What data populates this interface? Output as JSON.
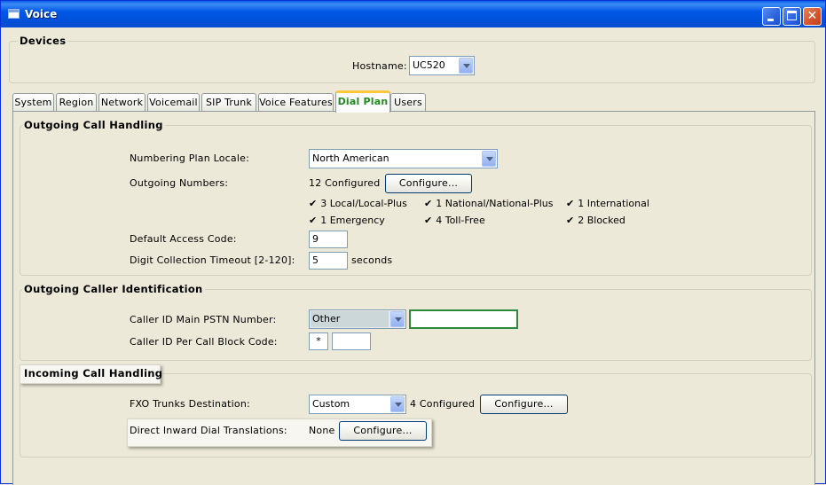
{
  "window": {
    "title": "Voice"
  },
  "devices": {
    "legend": "Devices",
    "hostname_label": "Hostname:",
    "hostname_value": "UC520"
  },
  "tabs": [
    {
      "label": "System"
    },
    {
      "label": "Region"
    },
    {
      "label": "Network"
    },
    {
      "label": "Voicemail"
    },
    {
      "label": "SIP Trunk"
    },
    {
      "label": "Voice Features"
    },
    {
      "label": "Dial Plan",
      "active": true
    },
    {
      "label": "Users"
    }
  ],
  "outgoing": {
    "legend": "Outgoing Call Handling",
    "locale_label": "Numbering Plan Locale:",
    "locale_value": "North American",
    "numbers_label": "Outgoing Numbers:",
    "numbers_status": "12 Configured",
    "configure_label": "Configure...",
    "checks": [
      "3 Local/Local-Plus",
      "1 National/National-Plus",
      "1 International",
      "1 Emergency",
      "4 Toll-Free",
      "2 Blocked"
    ],
    "access_code_label": "Default Access Code:",
    "access_code_value": "9",
    "timeout_label": "Digit Collection Timeout [2-120]:",
    "timeout_value": "5",
    "timeout_unit": "seconds"
  },
  "caller_id": {
    "legend": "Outgoing Caller Identification",
    "main_number_label": "Caller ID Main PSTN Number:",
    "main_number_select": "Other",
    "main_number_value": "",
    "block_code_label": "Caller ID Per Call Block Code:",
    "block_code_prefix": "*",
    "block_code_value": ""
  },
  "incoming": {
    "legend": "Incoming Call Handling",
    "fxo_label": "FXO Trunks Destination:",
    "fxo_value": "Custom",
    "fxo_status": "4 Configured",
    "fxo_configure_label": "Configure...",
    "did_label": "Direct Inward Dial Translations:",
    "did_status": "None",
    "did_configure_label": "Configure..."
  },
  "colors": {
    "titlebar": "#0058E6",
    "active_tab_text": "#218C1E",
    "active_tab_top": "#FFC83C",
    "input_focus_border": "#2E8B3E"
  },
  "icons": [
    "app-icon",
    "minimize-icon",
    "maximize-icon",
    "close-icon",
    "checkmark-icon",
    "chevron-down-icon"
  ]
}
